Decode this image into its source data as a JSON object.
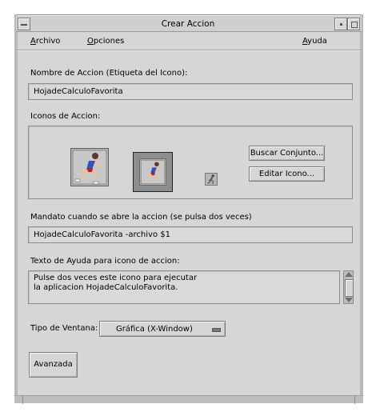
{
  "window": {
    "title": "Crear Accion"
  },
  "menubar": {
    "archivo": "Archivo",
    "opciones": "Opciones",
    "ayuda": "Ayuda"
  },
  "action_name": {
    "label": "Nombre de Accion (Etiqueta del Icono):",
    "value": "HojadeCalculoFavorita"
  },
  "action_icons": {
    "label": "Iconos de Accion:",
    "find_set_button": "Buscar Conjunto...",
    "edit_icon_button": "Editar Icono..."
  },
  "command": {
    "label": "Mandato cuando se abre la accion (se pulsa dos veces)",
    "value": "HojadeCalculoFavorita -archivo $1"
  },
  "help_text": {
    "label": "Texto de Ayuda para icono de accion:",
    "line1": "Pulse dos veces este icono para ejecutar",
    "line2": "la aplicacion HojadeCalculoFavorita."
  },
  "window_type": {
    "label": "Tipo de Ventana:",
    "selected": "Gráfica (X-Window)"
  },
  "advanced_button": "Avanzada",
  "colors": {
    "background": "#d6d6d6",
    "field": "#d9d9d9",
    "border": "#8c8c8c"
  },
  "icons": [
    "window-menu-icon",
    "minimize-icon",
    "maximize-icon",
    "runner-icon",
    "option-indicator-icon",
    "scroll-up-icon",
    "scroll-down-icon"
  ]
}
